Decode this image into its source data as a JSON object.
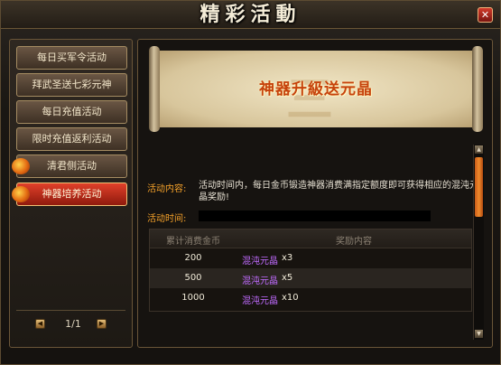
{
  "window": {
    "title": "精彩活動",
    "close_icon": "close-icon"
  },
  "sidebar": {
    "items": [
      {
        "label": "每日买军令活动",
        "selected": false,
        "badge": false
      },
      {
        "label": "拜武圣送七彩元神",
        "selected": false,
        "badge": false
      },
      {
        "label": "每日充值活动",
        "selected": false,
        "badge": false
      },
      {
        "label": "限时充值返利活动",
        "selected": false,
        "badge": false
      },
      {
        "label": "清君侧活动",
        "selected": false,
        "badge": true
      },
      {
        "label": "神器培养活动",
        "selected": true,
        "badge": true
      }
    ],
    "pager": {
      "text": "1/1",
      "prev_icon": "arrow-left-icon",
      "next_icon": "arrow-right-icon"
    }
  },
  "detail": {
    "banner_title": "神器升級送元晶",
    "content_label": "活动内容:",
    "content_text": "活动时间内，每日金币锻造神器消费满指定额度即可获得相应的混沌元晶奖励!",
    "time_label": "活动时间:",
    "table": {
      "headers": [
        "累计消费金币",
        "奖励内容"
      ],
      "rows": [
        {
          "amount": "200",
          "item": "混沌元晶",
          "qty": "x3"
        },
        {
          "amount": "500",
          "item": "混沌元晶",
          "qty": "x5"
        },
        {
          "amount": "1000",
          "item": "混沌元晶",
          "qty": "x10"
        }
      ]
    }
  },
  "colors": {
    "accent_orange": "#f4a12a",
    "banner_text": "#c6420b",
    "item_purple": "#c06bff",
    "selected_red": "#e0402a"
  }
}
